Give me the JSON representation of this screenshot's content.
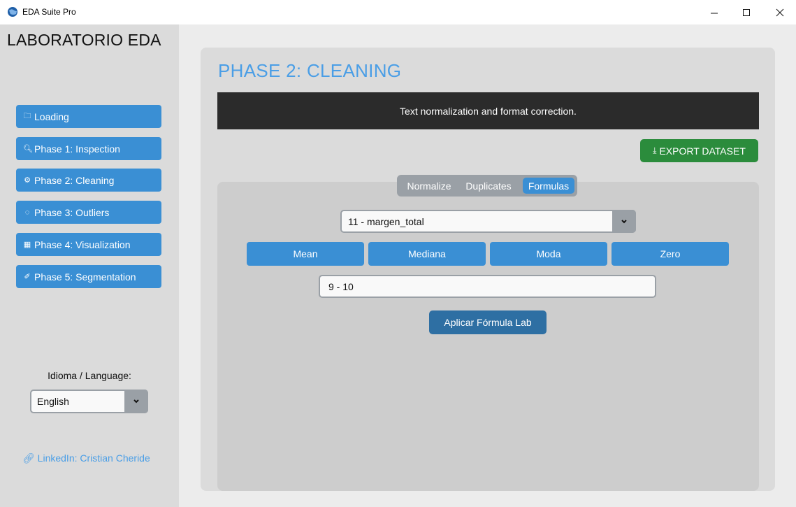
{
  "window": {
    "title": "EDA Suite Pro",
    "controls": {
      "minimize": "minimize-icon",
      "maximize": "maximize-icon",
      "close": "close-icon"
    }
  },
  "sidebar": {
    "brand": "LABORATORIO EDA",
    "items": [
      {
        "icon": "folder-icon",
        "glyph": "🗀",
        "label": "Loading"
      },
      {
        "icon": "magnifier-icon",
        "glyph": "🔍︎",
        "label": "Phase 1: Inspection"
      },
      {
        "icon": "gear-icon",
        "glyph": "⚙",
        "label": "Phase 2: Cleaning"
      },
      {
        "icon": "outliers-icon",
        "glyph": "◌",
        "label": "Phase 3: Outliers"
      },
      {
        "icon": "bar-chart-icon",
        "glyph": "▦",
        "label": "Phase 4: Visualization"
      },
      {
        "icon": "segment-icon",
        "glyph": "✐",
        "label": "Phase 5: Segmentation"
      }
    ],
    "language_label": "Idioma / Language:",
    "language_value": "English",
    "linkedin": "LinkedIn: Cristian Cheride"
  },
  "main": {
    "title": "PHASE 2: CLEANING",
    "description": "Text normalization and format correction.",
    "export_label": "EXPORT DATASET",
    "tabs": [
      {
        "label": "Normalize",
        "selected": false
      },
      {
        "label": "Duplicates",
        "selected": false
      },
      {
        "label": "Formulas",
        "selected": true
      }
    ],
    "column_select_value": "11 - margen_total",
    "fill_buttons": [
      "Mean",
      "Mediana",
      "Moda",
      "Zero"
    ],
    "formula_value": "9 - 10",
    "apply_label": "Aplicar Fórmula Lab"
  },
  "colors": {
    "accent_blue": "#3a8fd4",
    "title_blue": "#4a9ee6",
    "export_green": "#2b8c3c",
    "apply_blue": "#2e6fa3",
    "dark_bar": "#2b2b2b"
  }
}
